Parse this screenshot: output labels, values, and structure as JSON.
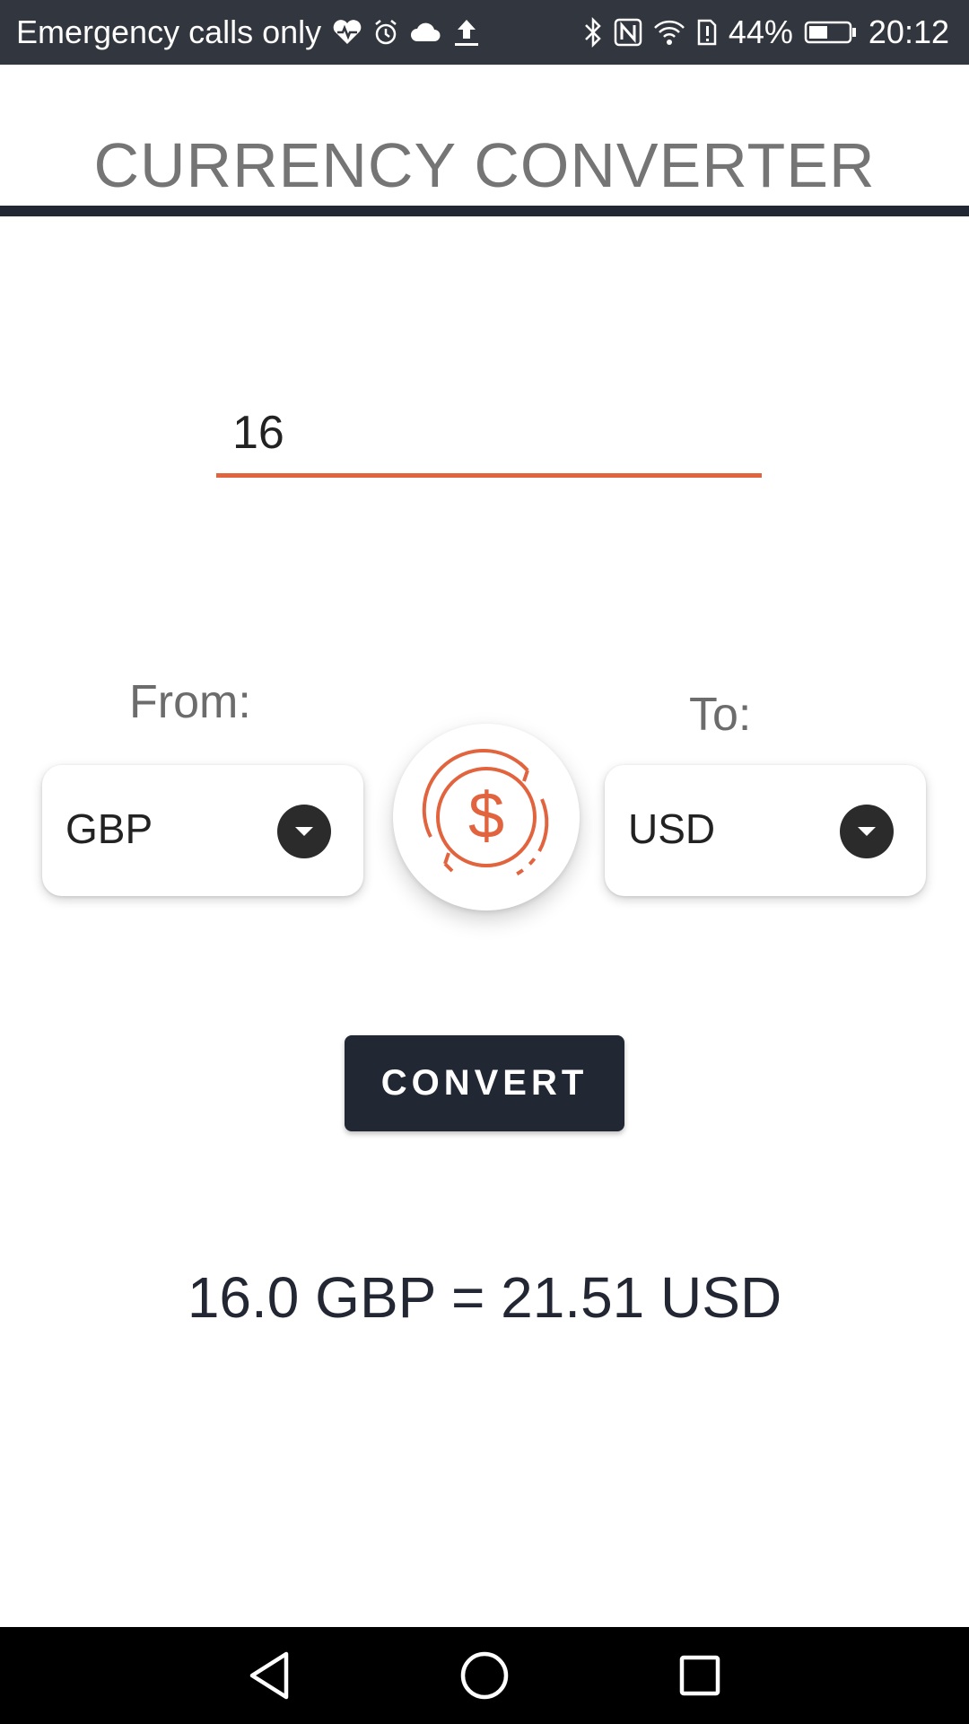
{
  "status_bar": {
    "carrier": "Emergency calls only",
    "battery": "44%",
    "time": "20:12",
    "icons_left": [
      "heart-rate-icon",
      "alarm-icon",
      "cloud-icon",
      "upload-icon"
    ],
    "icons_right": [
      "bluetooth-icon",
      "nfc-icon",
      "wifi-icon",
      "sim-alert-icon",
      "battery-icon"
    ]
  },
  "header": {
    "title": "CURRENCY CONVERTER"
  },
  "amount": {
    "value": "16"
  },
  "from": {
    "label": "From:",
    "currency": "GBP"
  },
  "to": {
    "label": "To:",
    "currency": "USD"
  },
  "convert_button": {
    "label": "CONVERT"
  },
  "result": {
    "text": "16.0 GBP = 21.51 USD"
  },
  "colors": {
    "accent": "#e2643f",
    "dark": "#212733",
    "status_bar": "#32363f"
  },
  "nav_bar": {
    "buttons": [
      "back-icon",
      "home-icon",
      "recent-apps-icon"
    ]
  }
}
